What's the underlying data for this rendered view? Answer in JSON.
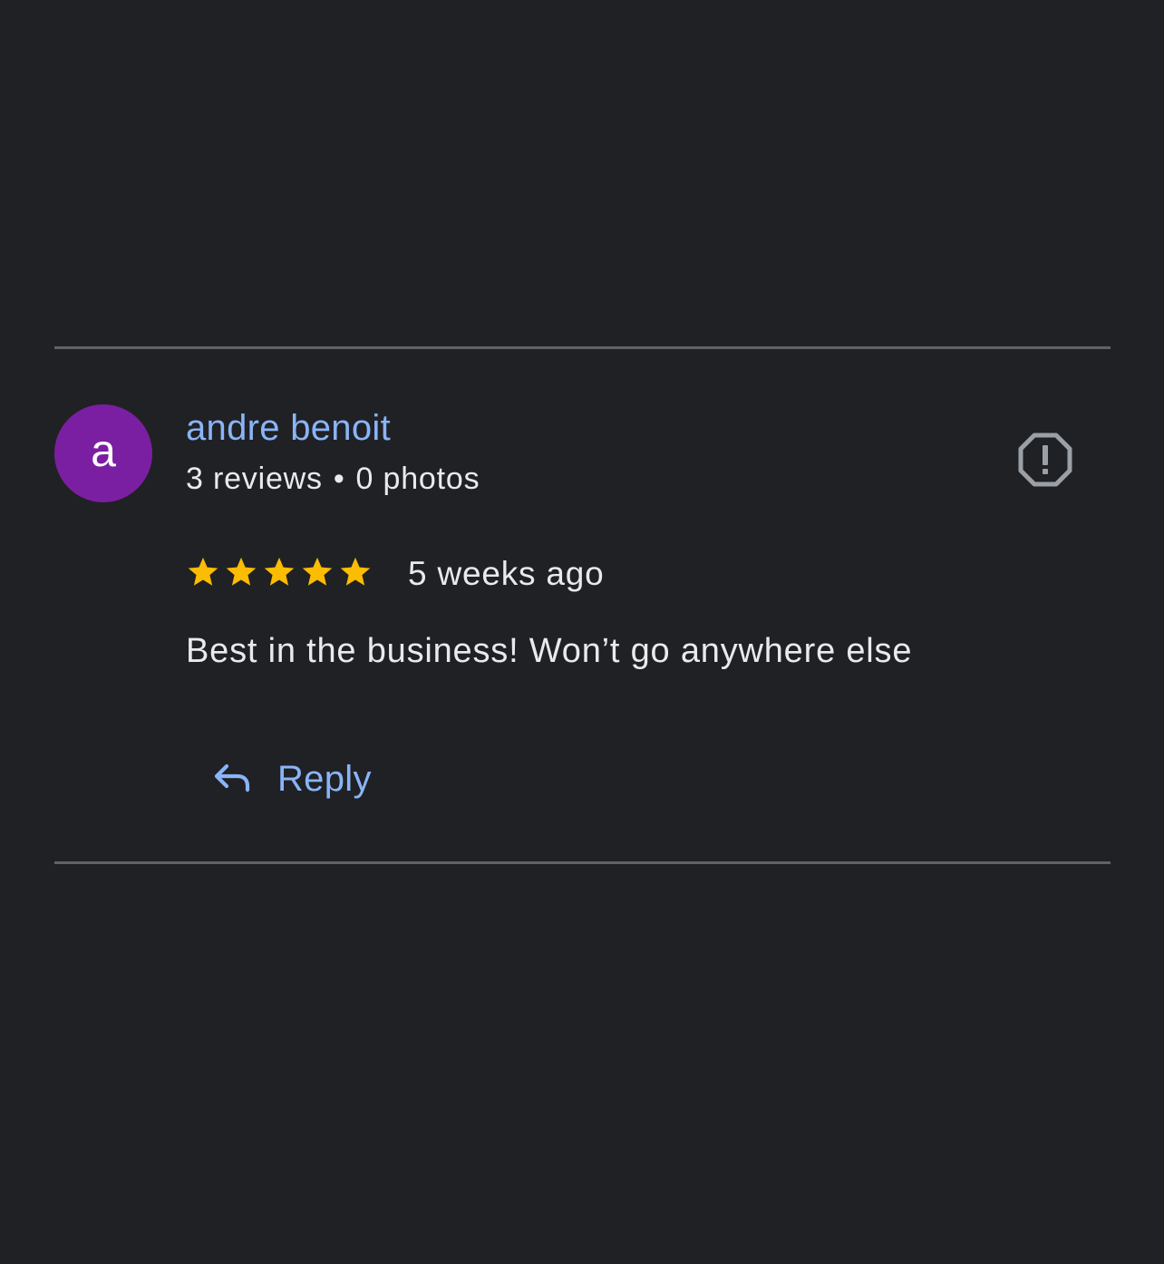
{
  "review": {
    "avatar_letter": "a",
    "avatar_color": "#7b1fa2",
    "reviewer_name": "andre benoit",
    "reviews_count": "3 reviews",
    "separator": "•",
    "photos_count": "0 photos",
    "rating": 5,
    "rating_max": 5,
    "star_color": "#fbbc04",
    "date": "5 weeks ago",
    "text": "Best in the business! Won’t go anywhere else",
    "report_icon": "report-flag-icon",
    "reply_icon": "reply-arrow-icon",
    "reply_label": "Reply"
  },
  "colors": {
    "background": "#202124",
    "link_blue": "#8ab4f8",
    "text_primary": "#e8eaed",
    "divider": "#5f6368"
  }
}
